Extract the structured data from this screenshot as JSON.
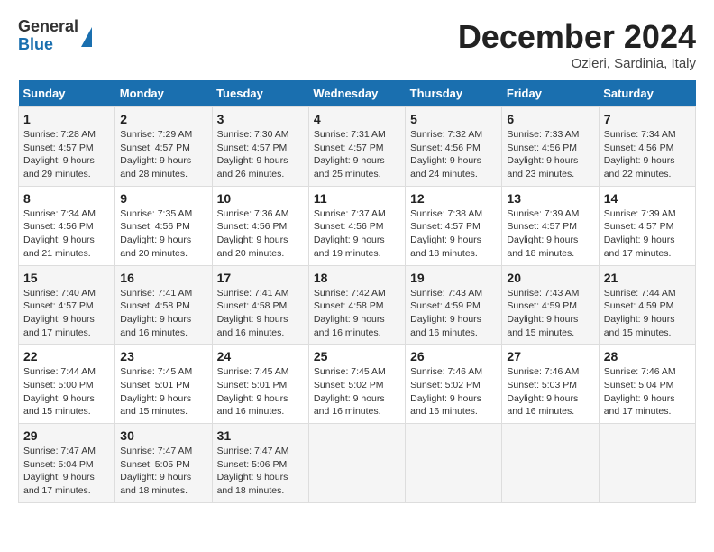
{
  "header": {
    "logo_line1": "General",
    "logo_line2": "Blue",
    "month_title": "December 2024",
    "location": "Ozieri, Sardinia, Italy"
  },
  "weekdays": [
    "Sunday",
    "Monday",
    "Tuesday",
    "Wednesday",
    "Thursday",
    "Friday",
    "Saturday"
  ],
  "weeks": [
    [
      {
        "day": "1",
        "sunrise": "Sunrise: 7:28 AM",
        "sunset": "Sunset: 4:57 PM",
        "daylight": "Daylight: 9 hours and 29 minutes."
      },
      {
        "day": "2",
        "sunrise": "Sunrise: 7:29 AM",
        "sunset": "Sunset: 4:57 PM",
        "daylight": "Daylight: 9 hours and 28 minutes."
      },
      {
        "day": "3",
        "sunrise": "Sunrise: 7:30 AM",
        "sunset": "Sunset: 4:57 PM",
        "daylight": "Daylight: 9 hours and 26 minutes."
      },
      {
        "day": "4",
        "sunrise": "Sunrise: 7:31 AM",
        "sunset": "Sunset: 4:57 PM",
        "daylight": "Daylight: 9 hours and 25 minutes."
      },
      {
        "day": "5",
        "sunrise": "Sunrise: 7:32 AM",
        "sunset": "Sunset: 4:56 PM",
        "daylight": "Daylight: 9 hours and 24 minutes."
      },
      {
        "day": "6",
        "sunrise": "Sunrise: 7:33 AM",
        "sunset": "Sunset: 4:56 PM",
        "daylight": "Daylight: 9 hours and 23 minutes."
      },
      {
        "day": "7",
        "sunrise": "Sunrise: 7:34 AM",
        "sunset": "Sunset: 4:56 PM",
        "daylight": "Daylight: 9 hours and 22 minutes."
      }
    ],
    [
      {
        "day": "8",
        "sunrise": "Sunrise: 7:34 AM",
        "sunset": "Sunset: 4:56 PM",
        "daylight": "Daylight: 9 hours and 21 minutes."
      },
      {
        "day": "9",
        "sunrise": "Sunrise: 7:35 AM",
        "sunset": "Sunset: 4:56 PM",
        "daylight": "Daylight: 9 hours and 20 minutes."
      },
      {
        "day": "10",
        "sunrise": "Sunrise: 7:36 AM",
        "sunset": "Sunset: 4:56 PM",
        "daylight": "Daylight: 9 hours and 20 minutes."
      },
      {
        "day": "11",
        "sunrise": "Sunrise: 7:37 AM",
        "sunset": "Sunset: 4:56 PM",
        "daylight": "Daylight: 9 hours and 19 minutes."
      },
      {
        "day": "12",
        "sunrise": "Sunrise: 7:38 AM",
        "sunset": "Sunset: 4:57 PM",
        "daylight": "Daylight: 9 hours and 18 minutes."
      },
      {
        "day": "13",
        "sunrise": "Sunrise: 7:39 AM",
        "sunset": "Sunset: 4:57 PM",
        "daylight": "Daylight: 9 hours and 18 minutes."
      },
      {
        "day": "14",
        "sunrise": "Sunrise: 7:39 AM",
        "sunset": "Sunset: 4:57 PM",
        "daylight": "Daylight: 9 hours and 17 minutes."
      }
    ],
    [
      {
        "day": "15",
        "sunrise": "Sunrise: 7:40 AM",
        "sunset": "Sunset: 4:57 PM",
        "daylight": "Daylight: 9 hours and 17 minutes."
      },
      {
        "day": "16",
        "sunrise": "Sunrise: 7:41 AM",
        "sunset": "Sunset: 4:58 PM",
        "daylight": "Daylight: 9 hours and 16 minutes."
      },
      {
        "day": "17",
        "sunrise": "Sunrise: 7:41 AM",
        "sunset": "Sunset: 4:58 PM",
        "daylight": "Daylight: 9 hours and 16 minutes."
      },
      {
        "day": "18",
        "sunrise": "Sunrise: 7:42 AM",
        "sunset": "Sunset: 4:58 PM",
        "daylight": "Daylight: 9 hours and 16 minutes."
      },
      {
        "day": "19",
        "sunrise": "Sunrise: 7:43 AM",
        "sunset": "Sunset: 4:59 PM",
        "daylight": "Daylight: 9 hours and 16 minutes."
      },
      {
        "day": "20",
        "sunrise": "Sunrise: 7:43 AM",
        "sunset": "Sunset: 4:59 PM",
        "daylight": "Daylight: 9 hours and 15 minutes."
      },
      {
        "day": "21",
        "sunrise": "Sunrise: 7:44 AM",
        "sunset": "Sunset: 4:59 PM",
        "daylight": "Daylight: 9 hours and 15 minutes."
      }
    ],
    [
      {
        "day": "22",
        "sunrise": "Sunrise: 7:44 AM",
        "sunset": "Sunset: 5:00 PM",
        "daylight": "Daylight: 9 hours and 15 minutes."
      },
      {
        "day": "23",
        "sunrise": "Sunrise: 7:45 AM",
        "sunset": "Sunset: 5:01 PM",
        "daylight": "Daylight: 9 hours and 15 minutes."
      },
      {
        "day": "24",
        "sunrise": "Sunrise: 7:45 AM",
        "sunset": "Sunset: 5:01 PM",
        "daylight": "Daylight: 9 hours and 16 minutes."
      },
      {
        "day": "25",
        "sunrise": "Sunrise: 7:45 AM",
        "sunset": "Sunset: 5:02 PM",
        "daylight": "Daylight: 9 hours and 16 minutes."
      },
      {
        "day": "26",
        "sunrise": "Sunrise: 7:46 AM",
        "sunset": "Sunset: 5:02 PM",
        "daylight": "Daylight: 9 hours and 16 minutes."
      },
      {
        "day": "27",
        "sunrise": "Sunrise: 7:46 AM",
        "sunset": "Sunset: 5:03 PM",
        "daylight": "Daylight: 9 hours and 16 minutes."
      },
      {
        "day": "28",
        "sunrise": "Sunrise: 7:46 AM",
        "sunset": "Sunset: 5:04 PM",
        "daylight": "Daylight: 9 hours and 17 minutes."
      }
    ],
    [
      {
        "day": "29",
        "sunrise": "Sunrise: 7:47 AM",
        "sunset": "Sunset: 5:04 PM",
        "daylight": "Daylight: 9 hours and 17 minutes."
      },
      {
        "day": "30",
        "sunrise": "Sunrise: 7:47 AM",
        "sunset": "Sunset: 5:05 PM",
        "daylight": "Daylight: 9 hours and 18 minutes."
      },
      {
        "day": "31",
        "sunrise": "Sunrise: 7:47 AM",
        "sunset": "Sunset: 5:06 PM",
        "daylight": "Daylight: 9 hours and 18 minutes."
      },
      null,
      null,
      null,
      null
    ]
  ]
}
